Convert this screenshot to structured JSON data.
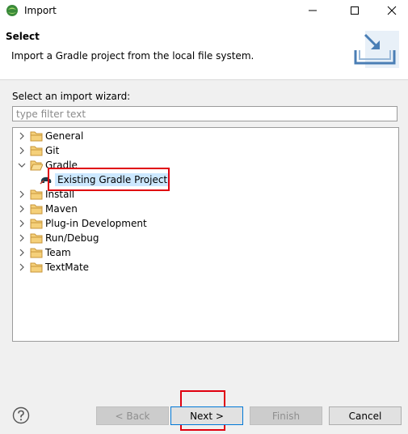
{
  "window": {
    "title": "Import"
  },
  "header": {
    "title": "Select",
    "description": "Import a Gradle project from the local file system."
  },
  "wizard": {
    "prompt": "Select an import wizard:",
    "filter_placeholder": "type filter text",
    "tree": [
      {
        "label": "General",
        "expanded": false
      },
      {
        "label": "Git",
        "expanded": false
      },
      {
        "label": "Gradle",
        "expanded": true,
        "children": [
          {
            "label": "Existing Gradle Project",
            "selected": true
          }
        ]
      },
      {
        "label": "Install",
        "expanded": false
      },
      {
        "label": "Maven",
        "expanded": false
      },
      {
        "label": "Plug-in Development",
        "expanded": false
      },
      {
        "label": "Run/Debug",
        "expanded": false
      },
      {
        "label": "Team",
        "expanded": false
      },
      {
        "label": "TextMate",
        "expanded": false
      }
    ]
  },
  "buttons": {
    "back": "< Back",
    "next": "Next >",
    "finish": "Finish",
    "cancel": "Cancel"
  },
  "colors": {
    "highlight": "#e0000f",
    "selection": "#cce8ff",
    "default_button_border": "#0078d7",
    "folder": "#e8b64a"
  }
}
